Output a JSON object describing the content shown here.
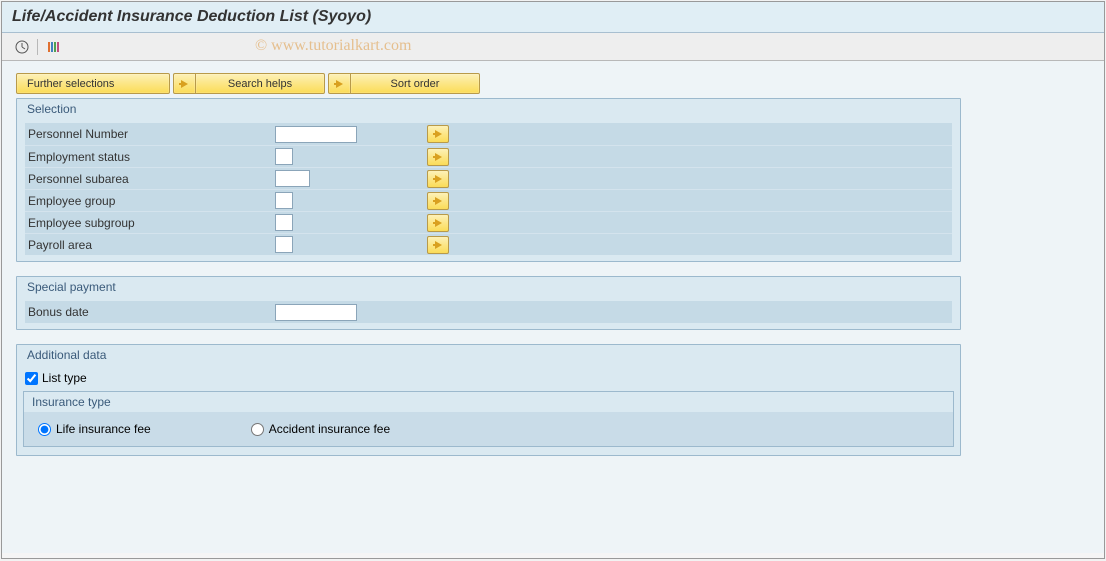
{
  "header": {
    "title": "Life/Accident Insurance Deduction List (Syoyo)"
  },
  "topbar": {
    "further_selections": "Further selections",
    "search_helps": "Search helps",
    "sort_order": "Sort order"
  },
  "groups": {
    "selection": {
      "title": "Selection",
      "rows": {
        "personnel_number": "Personnel Number",
        "employment_status": "Employment status",
        "personnel_subarea": "Personnel subarea",
        "employee_group": "Employee group",
        "employee_subgroup": "Employee subgroup",
        "payroll_area": "Payroll area"
      }
    },
    "special_payment": {
      "title": "Special payment",
      "bonus_date": "Bonus date"
    },
    "additional_data": {
      "title": "Additional data",
      "list_type": "List type",
      "insurance_type_title": "Insurance type",
      "life_fee": "Life insurance fee",
      "accident_fee": "Accident insurance fee"
    }
  },
  "watermark": "© www.tutorialkart.com"
}
